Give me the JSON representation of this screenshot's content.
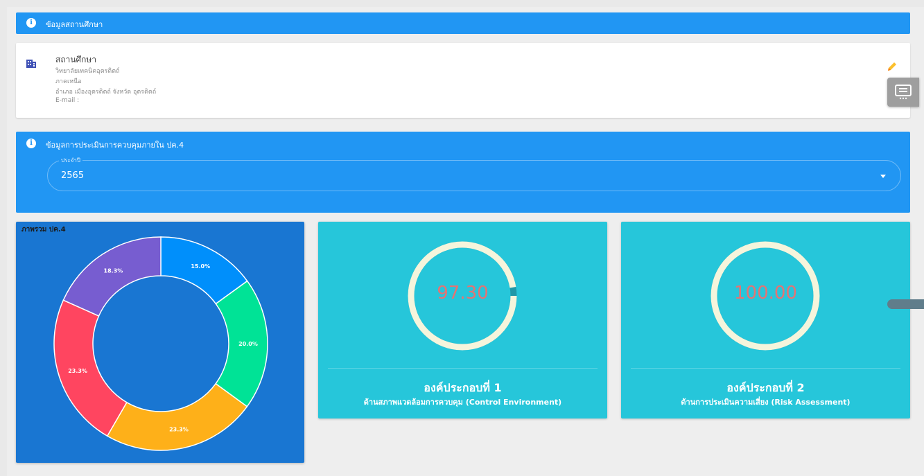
{
  "school_section": {
    "title": "ข้อมูลสถานศึกษา",
    "label": "สถานศึกษา",
    "name": "วิทยาลัยเทคนิคอุตรดิตถ์",
    "region": "ภาคเหนือ",
    "address": "อำเภอ เมืองอุตรดิตถ์ จังหวัด อุตรดิตถ์",
    "email": "E-mail :"
  },
  "assessment_section": {
    "title": "ข้อมูลการประเมินการควบคุมภายใน ปค.4",
    "year_label": "ประจำปี",
    "year_value": "2565"
  },
  "chart_data": [
    {
      "type": "pie",
      "title": "ภาพรวม ปค.4",
      "values": [
        15.0,
        20.0,
        23.3,
        23.3,
        18.3
      ],
      "labels": [
        "15.0%",
        "20.0%",
        "23.3%",
        "23.3%",
        "18.3%"
      ],
      "colors": [
        "#008ffb",
        "#00e396",
        "#feb019",
        "#ff4560",
        "#775dd0"
      ],
      "donut": true
    }
  ],
  "gauges": [
    {
      "value": "97.30",
      "percent": 97.3,
      "title": "องค์ประกอบที่ 1",
      "subtitle": "ด้านสภาพแวดล้อมการควบคุม (Control Environment)"
    },
    {
      "value": "100.00",
      "percent": 100,
      "title": "องค์ประกอบที่ 2",
      "subtitle": "ด้านการประเมินความเสี่ยง (Risk Assessment)"
    }
  ],
  "colors": {
    "primary": "#2196f3",
    "pie_card": "#1976d2",
    "gauge_card": "#26c6da",
    "gauge_ring": "#f5f5dc",
    "gauge_value": "#e57373"
  },
  "icons": [
    "info-icon",
    "building-icon",
    "pencil-icon",
    "chat-icon",
    "chevron-down-icon"
  ]
}
